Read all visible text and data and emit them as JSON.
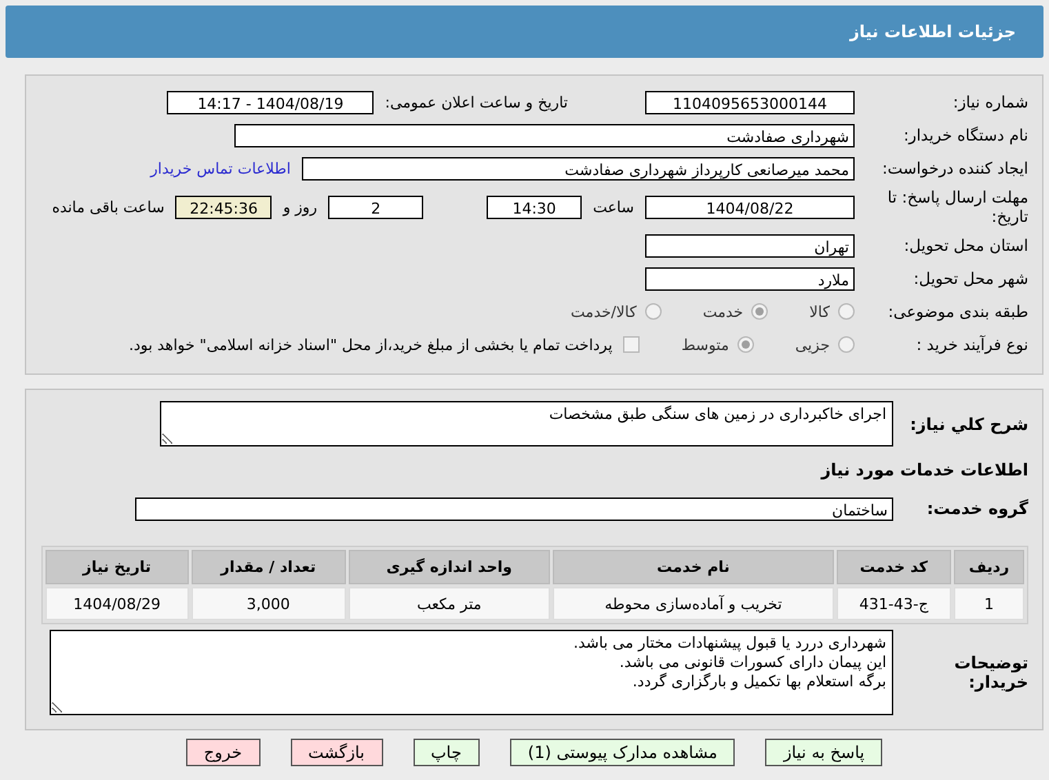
{
  "header": {
    "title": "جزئیات اطلاعات نیاز"
  },
  "need_number": {
    "label": "شماره نیاز:",
    "value": "1104095653000144"
  },
  "announce": {
    "label": "تاریخ و ساعت اعلان عمومی:",
    "value": "1404/08/19 - 14:17"
  },
  "buyer": {
    "label": "نام دستگاه خریدار:",
    "value": "شهرداری صفادشت"
  },
  "creator": {
    "label": "ایجاد کننده درخواست:",
    "value": "محمد میرصانعی کارپرداز شهرداری صفادشت",
    "link": "اطلاعات تماس خریدار"
  },
  "deadline": {
    "label": "مهلت ارسال پاسخ: تا تاریخ:",
    "date": "1404/08/22",
    "time_label": "ساعت",
    "time": "14:30",
    "days": "2",
    "days_label": "روز و",
    "remaining": "22:45:36",
    "remaining_label": "ساعت باقی مانده"
  },
  "province": {
    "label": "استان محل تحویل:",
    "value": "تهران"
  },
  "city": {
    "label": "شهر محل تحویل:",
    "value": "ملارد"
  },
  "category": {
    "label": "طبقه بندی موضوعی:",
    "options": [
      {
        "label": "کالا",
        "selected": false
      },
      {
        "label": "خدمت",
        "selected": true
      },
      {
        "label": "کالا/خدمت",
        "selected": false
      }
    ]
  },
  "purchase_type": {
    "label": "نوع فرآیند خرید :",
    "options": [
      {
        "label": "جزیی",
        "selected": false
      },
      {
        "label": "متوسط",
        "selected": true
      }
    ],
    "payment": {
      "checked": false,
      "text": "پرداخت تمام یا بخشی از مبلغ خرید،از محل \"اسناد خزانه اسلامی\" خواهد بود."
    }
  },
  "description": {
    "label": "شرح کلي نیاز:",
    "value": "اجرای خاکبرداری در زمین های سنگی طبق مشخصات"
  },
  "services_title": "اطلاعات خدمات مورد نیاز",
  "service_group": {
    "label": "گروه خدمت:",
    "value": "ساختمان"
  },
  "table": {
    "columns": [
      "ردیف",
      "کد خدمت",
      "نام خدمت",
      "واحد اندازه گیری",
      "تعداد / مقدار",
      "تاریخ نیاز"
    ],
    "rows": [
      [
        "1",
        "ج-43-431",
        "تخریب و آماده‌سازی محوطه",
        "متر مکعب",
        "3,000",
        "1404/08/29"
      ]
    ]
  },
  "buyer_notes": {
    "label": "توضیحات خریدار:",
    "lines": [
      "شهرداری دررد یا قبول پیشنهادات مختار می باشد.",
      "این پیمان دارای کسورات قانونی می باشد.",
      "برگه استعلام بها تکمیل و بارگزاری گردد."
    ]
  },
  "buttons": [
    {
      "label": "پاسخ به نیاز",
      "kind": "normal"
    },
    {
      "label": "مشاهده مدارک پیوستی (1)",
      "kind": "normal"
    },
    {
      "label": "چاپ",
      "kind": "normal"
    },
    {
      "label": "بازگشت",
      "kind": "danger"
    },
    {
      "label": "خروج",
      "kind": "danger"
    }
  ]
}
